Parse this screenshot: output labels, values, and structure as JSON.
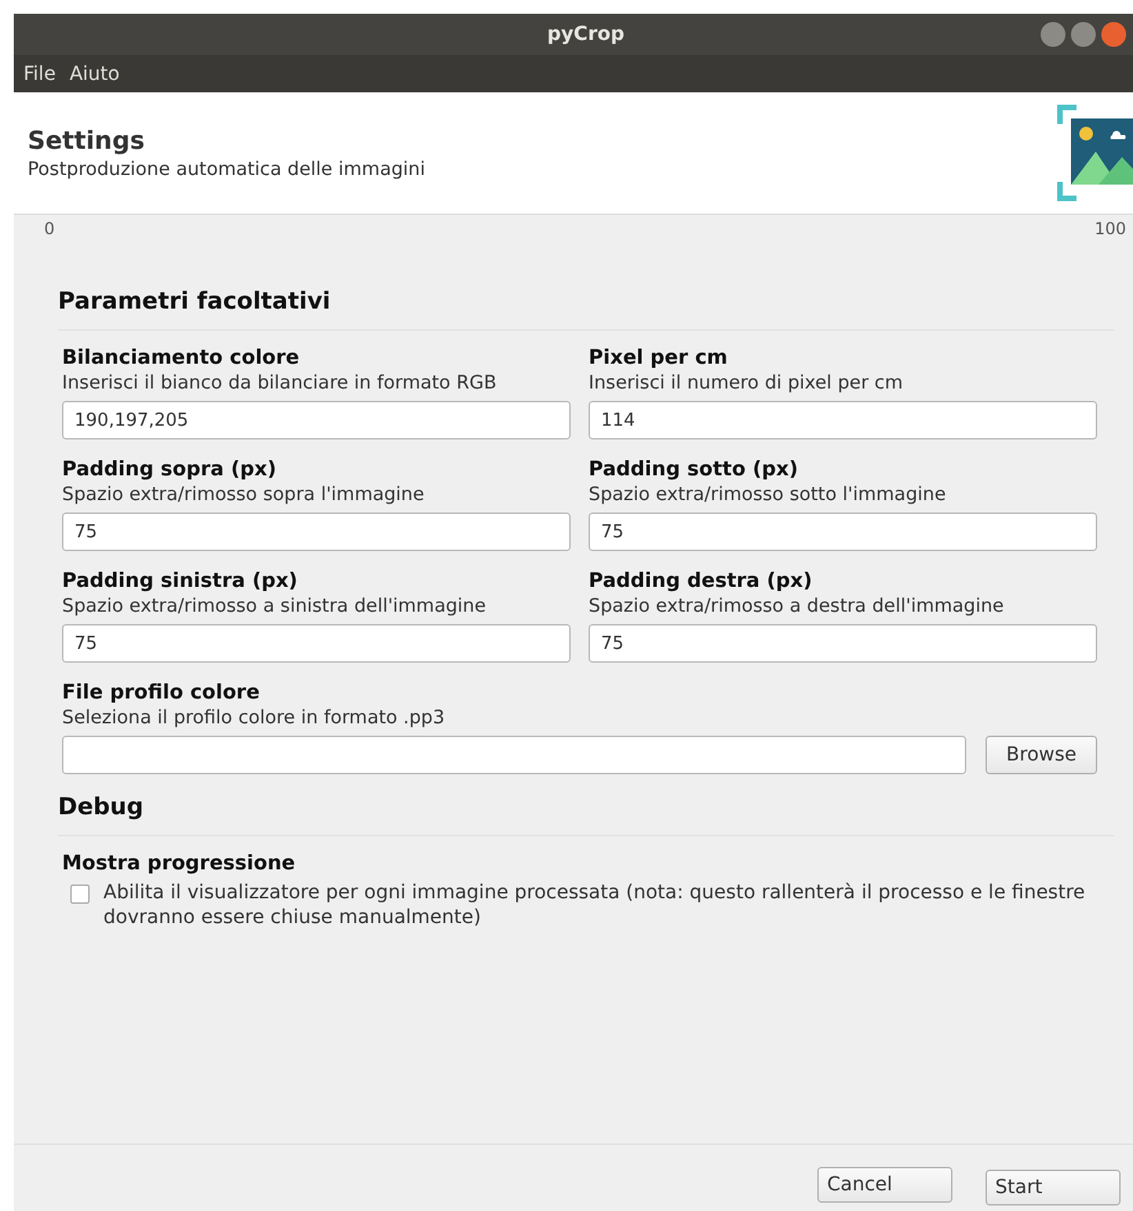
{
  "window": {
    "title": "pyCrop"
  },
  "menu": [
    "File",
    "Aiuto"
  ],
  "header": {
    "title": "Settings",
    "subtitle": "Postproduzione automatica delle immagini"
  },
  "progress": {
    "min_label": "0",
    "max_label": "100"
  },
  "sections": [
    {
      "title": "Parametri facoltativi",
      "fields": [
        {
          "kind": "text",
          "label": "Bilanciamento colore",
          "hint": "Inserisci il bianco da bilanciare in formato RGB",
          "value": "190,197,205"
        },
        {
          "kind": "text",
          "label": "Pixel per cm",
          "hint": "Inserisci il numero di pixel per cm",
          "value": "114"
        },
        {
          "kind": "text",
          "label": "Padding sopra (px)",
          "hint": "Spazio extra/rimosso sopra l'immagine",
          "value": "75"
        },
        {
          "kind": "text",
          "label": "Padding sotto (px)",
          "hint": "Spazio extra/rimosso sotto l'immagine",
          "value": "75"
        },
        {
          "kind": "text",
          "label": "Padding sinistra (px)",
          "hint": "Spazio extra/rimosso a sinistra dell'immagine",
          "value": "75"
        },
        {
          "kind": "text",
          "label": "Padding destra (px)",
          "hint": "Spazio extra/rimosso a destra dell'immagine",
          "value": "75"
        },
        {
          "kind": "file",
          "label": "File profilo colore",
          "hint": "Seleziona il profilo colore in formato .pp3",
          "button": "Browse"
        }
      ]
    },
    {
      "title": "Debug",
      "fields": [
        {
          "kind": "checkbox",
          "label": "Mostra progressione",
          "text": "Abilita il visualizzatore per ogni immagine processata (nota: questo rallenterà il processo e le finestre dovranno essere chiuse manualmente)",
          "checked": false
        }
      ]
    }
  ],
  "buttons": [
    "Cancel",
    "Start"
  ]
}
